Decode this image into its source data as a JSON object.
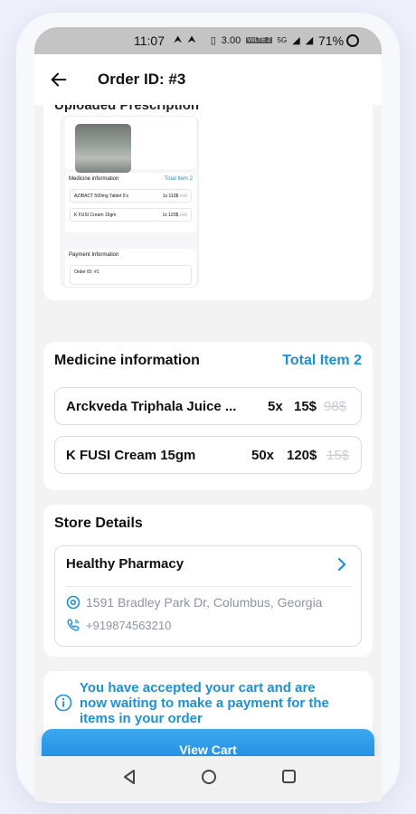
{
  "status": {
    "time": "11:07",
    "speed": "3.00",
    "speed_unit": "KB/S",
    "lte": "VoLTE 2",
    "net": "5G",
    "battery": "71%"
  },
  "header": {
    "title": "Order ID: #3"
  },
  "prescription": {
    "heading": "Uploaded Prescription",
    "thumb": {
      "med_heading": "Medicine information",
      "med_total": "Total Item 2",
      "rows": [
        {
          "name": "AZIBACT 500mg Tablet 5's",
          "qty": "1x",
          "price": "110$",
          "old": "20$"
        },
        {
          "name": "K FUSI Cream 15gm",
          "qty": "1x",
          "price": "120$",
          "old": "15$"
        }
      ],
      "pay_heading": "Payment Information",
      "order_label": "Order ID: #1"
    }
  },
  "medicine": {
    "title": "Medicine information",
    "total": "Total Item 2",
    "items": [
      {
        "name": "Arckveda Triphala Juice ...",
        "qty": "5x",
        "price": "15$",
        "old_price": "98$"
      },
      {
        "name": "K FUSI Cream 15gm",
        "qty": "50x",
        "price": "120$",
        "old_price": "15$"
      }
    ]
  },
  "store": {
    "title": "Store Details",
    "name": "Healthy Pharmacy",
    "address": "1591 Bradley Park Dr, Columbus, Georgia",
    "phone": "+919874563210"
  },
  "notice": {
    "text": "You have accepted your cart and are now waiting to make a payment for the items in your order"
  },
  "actions": {
    "view_cart": "View Cart"
  },
  "colors": {
    "accent": "#1e90d6",
    "muted": "#8d93a8"
  }
}
